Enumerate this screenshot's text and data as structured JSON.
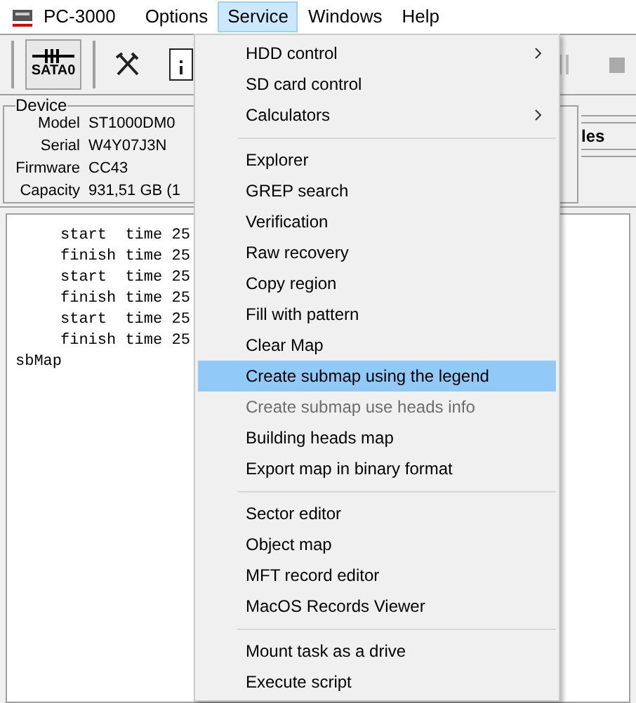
{
  "menubar": [
    {
      "label": "PC-3000",
      "kind": "app",
      "selected": false
    },
    {
      "label": "Options",
      "kind": "menu",
      "selected": false
    },
    {
      "label": "Service",
      "kind": "menu",
      "selected": true
    },
    {
      "label": "Windows",
      "kind": "menu",
      "selected": false
    },
    {
      "label": "Help",
      "kind": "menu",
      "selected": false
    }
  ],
  "toolbar": {
    "port_button": {
      "label": "SATA0",
      "selected": true
    }
  },
  "device": {
    "title": "Device",
    "fields": [
      {
        "label": "Model",
        "value": "ST1000DM0"
      },
      {
        "label": "Serial",
        "value": "W4Y07J3N"
      },
      {
        "label": "Firmware",
        "value": "CC43"
      },
      {
        "label": "Capacity",
        "value": "931,51 GB (1"
      }
    ]
  },
  "side_panel": {
    "title_fragment": "les"
  },
  "log": {
    "lines": [
      {
        "kind": "detail",
        "text": "start  time 25"
      },
      {
        "kind": "detail",
        "text": "finish time 25"
      },
      {
        "kind": "detail",
        "text": "start  time 25"
      },
      {
        "kind": "detail",
        "text": "finish time 25"
      },
      {
        "kind": "detail",
        "text": "start  time 25"
      },
      {
        "kind": "detail",
        "text": "finish time 25"
      },
      {
        "kind": "plain",
        "text": "sbMap"
      }
    ]
  },
  "service_menu": {
    "items": [
      {
        "kind": "item",
        "label": "HDD control",
        "submenu": true,
        "disabled": false,
        "selected": false
      },
      {
        "kind": "item",
        "label": "SD card control",
        "submenu": false,
        "disabled": false,
        "selected": false
      },
      {
        "kind": "item",
        "label": "Calculators",
        "submenu": true,
        "disabled": false,
        "selected": false
      },
      {
        "kind": "separator"
      },
      {
        "kind": "item",
        "label": "Explorer",
        "submenu": false,
        "disabled": false,
        "selected": false
      },
      {
        "kind": "item",
        "label": "GREP search",
        "submenu": false,
        "disabled": false,
        "selected": false
      },
      {
        "kind": "item",
        "label": "Verification",
        "submenu": false,
        "disabled": false,
        "selected": false
      },
      {
        "kind": "item",
        "label": "Raw recovery",
        "submenu": false,
        "disabled": false,
        "selected": false
      },
      {
        "kind": "item",
        "label": "Copy region",
        "submenu": false,
        "disabled": false,
        "selected": false
      },
      {
        "kind": "item",
        "label": "Fill with pattern",
        "submenu": false,
        "disabled": false,
        "selected": false
      },
      {
        "kind": "item",
        "label": "Clear Map",
        "submenu": false,
        "disabled": false,
        "selected": false
      },
      {
        "kind": "item",
        "label": "Create submap using the legend",
        "submenu": false,
        "disabled": false,
        "selected": true
      },
      {
        "kind": "item",
        "label": "Create submap use heads info",
        "submenu": false,
        "disabled": true,
        "selected": false
      },
      {
        "kind": "item",
        "label": "Building heads map",
        "submenu": false,
        "disabled": false,
        "selected": false
      },
      {
        "kind": "item",
        "label": "Export map in binary format",
        "submenu": false,
        "disabled": false,
        "selected": false
      },
      {
        "kind": "separator"
      },
      {
        "kind": "item",
        "label": "Sector editor",
        "submenu": false,
        "disabled": false,
        "selected": false
      },
      {
        "kind": "item",
        "label": "Object map",
        "submenu": false,
        "disabled": false,
        "selected": false
      },
      {
        "kind": "item",
        "label": "MFT record editor",
        "submenu": false,
        "disabled": false,
        "selected": false
      },
      {
        "kind": "item",
        "label": "MacOS Records Viewer",
        "submenu": false,
        "disabled": false,
        "selected": false
      },
      {
        "kind": "separator"
      },
      {
        "kind": "item",
        "label": "Mount task as a drive",
        "submenu": false,
        "disabled": false,
        "selected": false
      },
      {
        "kind": "item",
        "label": "Execute script",
        "submenu": false,
        "disabled": false,
        "selected": false
      }
    ]
  }
}
